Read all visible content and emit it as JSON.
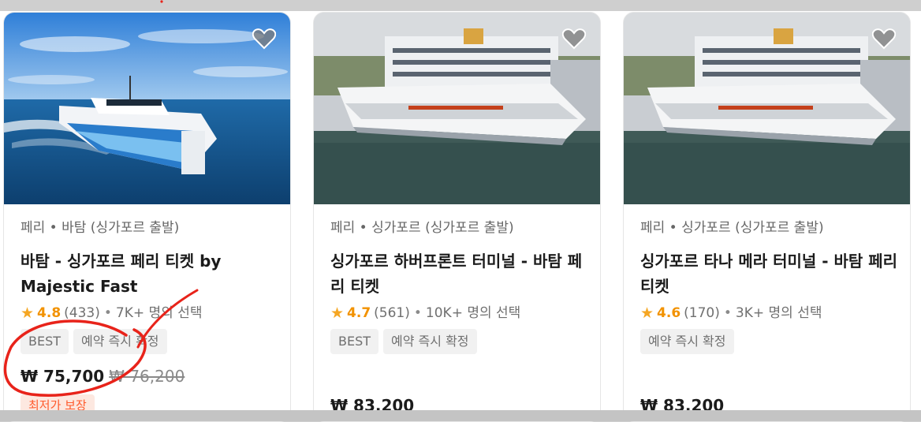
{
  "cards": [
    {
      "photo": "fast catamaran ferry cruising on open blue sea",
      "category": "페리 • 바탐 (싱가포르 출발)",
      "title": "바탐 - 싱가포르 페리 티켓 by Majestic Fast",
      "rating": "4.8",
      "reviews": "(433)",
      "popularity": "7K+ 명의 선택",
      "badges": [
        "BEST",
        "예약 즉시 확정"
      ],
      "price": "₩ 75,700",
      "original_price": "₩ 76,200",
      "guarantee": "최저가 보장",
      "icon": "heart-icon"
    },
    {
      "photo": "ferry docked at harbour in front of cruise ship",
      "category": "페리 • 싱가포르 (싱가포르 출발)",
      "title": "싱가포르 하버프론트 터미널 - 바탐 페리 티켓",
      "rating": "4.7",
      "reviews": "(561)",
      "popularity": "10K+ 명의 선택",
      "badges": [
        "BEST",
        "예약 즉시 확정"
      ],
      "price": "₩ 83,200",
      "icon": "heart-icon"
    },
    {
      "photo": "ferry docked at harbour in front of cruise ship",
      "category": "페리 • 싱가포르 (싱가포르 출발)",
      "title": "싱가포르 타나 메라 터미널 - 바탐 페리 티켓",
      "rating": "4.6",
      "reviews": "(170)",
      "popularity": "3K+ 명의 선택",
      "badges": [
        "예약 즉시 확정"
      ],
      "price": "₩ 83,200",
      "icon": "heart-icon"
    }
  ],
  "colors": {
    "star": "#f5a623",
    "rating_text": "#f29200",
    "annotation": "#e8231a",
    "guarantee_bg": "#fde8e0",
    "guarantee_text": "#ff5a2c"
  }
}
